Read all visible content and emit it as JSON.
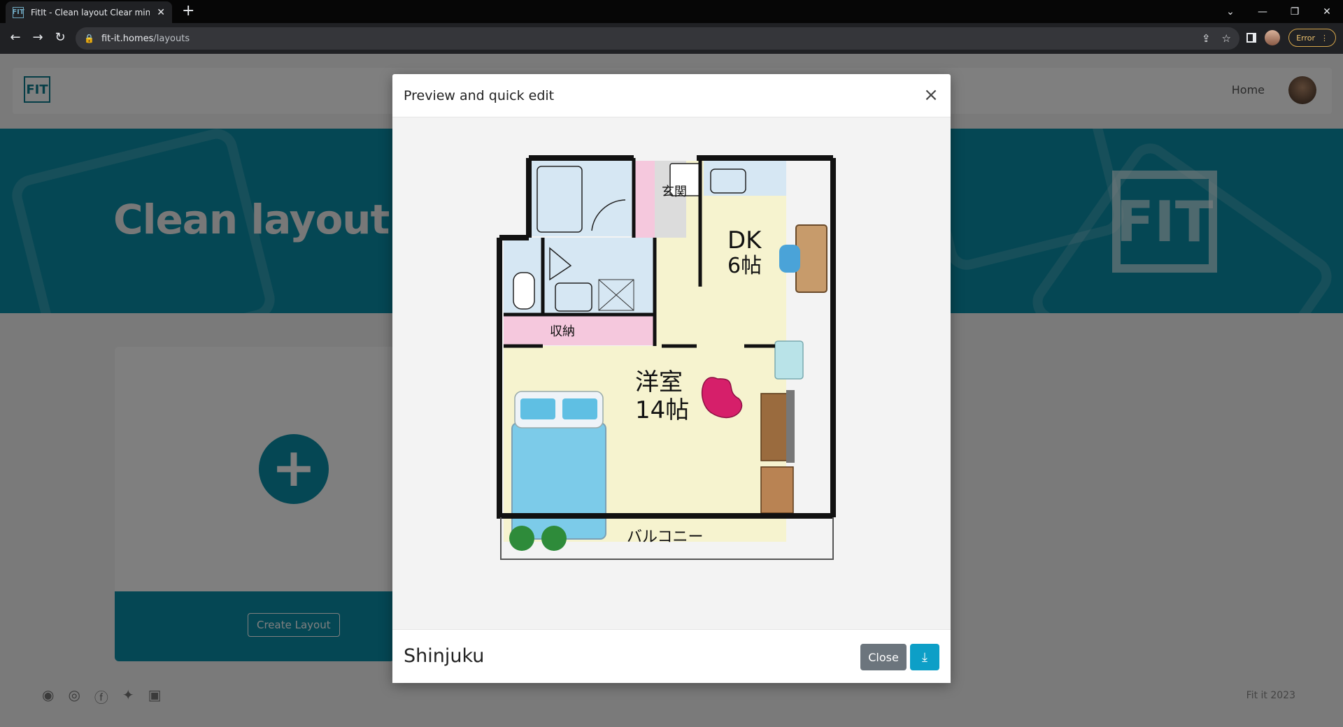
{
  "browser": {
    "tab_title": "FitIt - Clean layout Clear mind",
    "tab_favicon": "FIT",
    "url_host": "fit-it.homes",
    "url_path": "/layouts",
    "error_label": "Error",
    "icons": [
      "back-icon",
      "forward-icon",
      "reload-icon",
      "lock-icon",
      "share-icon",
      "star-icon",
      "side-panel-icon",
      "menu-dots-icon"
    ]
  },
  "navbar": {
    "logo_text": "FIT",
    "home_label": "Home"
  },
  "hero": {
    "title": "Clean layout C",
    "logo_text": "FIT"
  },
  "create_card": {
    "plus": "+",
    "button_label": "Create Layout"
  },
  "footer": {
    "social_icons": [
      "github-icon",
      "instagram-icon",
      "facebook-icon",
      "twitter-icon",
      "linkedin-icon"
    ],
    "copyright": "Fit it 2023"
  },
  "modal": {
    "title": "Preview and quick edit",
    "close_symbol": "×",
    "layout_name": "Shinjuku",
    "close_button_label": "Close",
    "download_icon": "download-icon"
  },
  "floorplan": {
    "rooms": {
      "entrance": "玄関",
      "storage": "収納",
      "dk_name": "DK",
      "dk_size": "6帖",
      "western_name": "洋室",
      "western_size": "14帖",
      "balcony": "バルコニー"
    }
  },
  "colors": {
    "brand_teal": "#0b8fa8",
    "close_button": "#6c757d",
    "download_button": "#0d9fc7",
    "room_floor": "#f6f3cf",
    "wet_area": "#d6e7f3",
    "storage_pink": "#f5c8dd"
  }
}
